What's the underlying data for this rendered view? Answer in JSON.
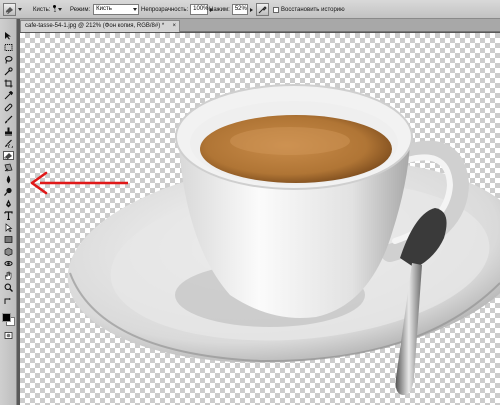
{
  "options_bar": {
    "brush_label": "Кисть:",
    "brush_size": "1",
    "mode_label": "Режим:",
    "mode_value": "Кисть",
    "opacity_label": "Непрозрачность:",
    "opacity_value": "100%",
    "pressure_label": "Нажим:",
    "pressure_value": "52%",
    "restore_history_label": "Восстановить историю"
  },
  "document_tab": {
    "title": "cafe-tasse-54-1.jpg @ 212% (Фон копия, RGB/8#) *",
    "close_glyph": "×"
  },
  "tools": {
    "active_tool": "eraser-icon",
    "icons": [
      "move-icon",
      "marquee-icon",
      "lasso-icon",
      "quick-select-icon",
      "crop-icon",
      "eyedropper-icon",
      "healing-icon",
      "brush-icon",
      "clone-stamp-icon",
      "history-brush-icon",
      "eraser-icon",
      "gradient-icon",
      "blur-icon",
      "dodge-icon",
      "pen-icon",
      "type-icon",
      "path-select-icon",
      "shape-icon",
      "3d-rotate-icon",
      "3d-orbit-icon",
      "hand-icon",
      "zoom-icon"
    ],
    "foreground_color": "#000000",
    "background_color": "#ffffff"
  },
  "annotation": {
    "arrow_color": "#e01818"
  }
}
